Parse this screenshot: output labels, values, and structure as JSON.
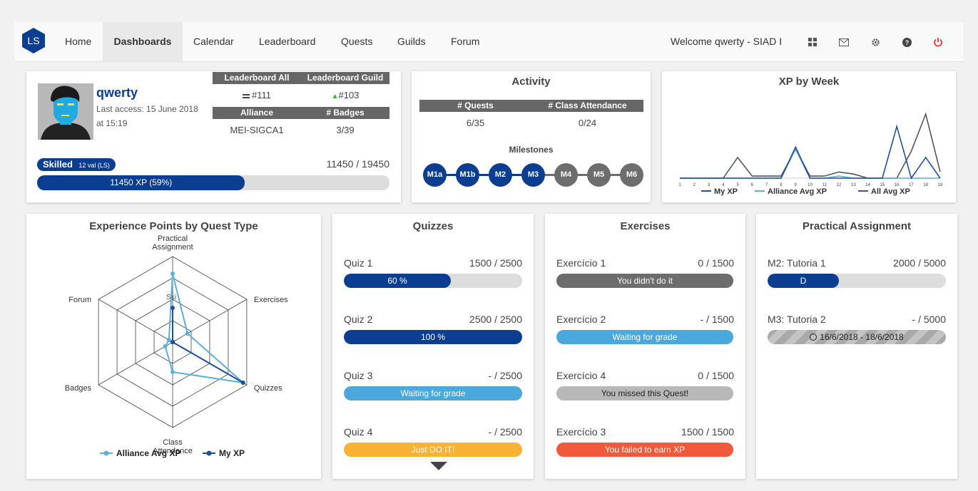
{
  "nav": {
    "logo_text": "LS",
    "items": [
      {
        "label": "Home",
        "active": false
      },
      {
        "label": "Dashboards",
        "active": true
      },
      {
        "label": "Calendar",
        "active": false
      },
      {
        "label": "Leaderboard",
        "active": false
      },
      {
        "label": "Quests",
        "active": false
      },
      {
        "label": "Guilds",
        "active": false
      },
      {
        "label": "Forum",
        "active": false
      }
    ],
    "welcome": "Welcome qwerty - SIAD I",
    "icons": [
      "grid-icon",
      "mail-icon",
      "gear-icon",
      "help-icon",
      "power-icon"
    ]
  },
  "profile": {
    "username": "qwerty",
    "last_access_line1": "Last access: 15 June 2018",
    "last_access_line2": "at 15:19",
    "lb_all_header": "Leaderboard All",
    "lb_guild_header": "Leaderboard Guild",
    "lb_all_value": "#111",
    "lb_guild_value": "#103",
    "alliance_header": "Alliance",
    "badges_header": "# Badges",
    "alliance_value": "MEI-SIGCA1",
    "badges_value": "3/39",
    "level_label": "Skilled",
    "level_sub": "12 val (LS)",
    "xp_total": "11450 / 19450",
    "xp_bar_text": "11450 XP (59%)",
    "xp_progress": 0.59,
    "accent": "#0b3d91"
  },
  "activity": {
    "title": "Activity",
    "quests_header": "# Quests",
    "attendance_header": "# Class Attendance",
    "quests_value": "6/35",
    "attendance_value": "0/24",
    "milestones_label": "Milestones",
    "milestones": [
      {
        "label": "M1a",
        "done": true
      },
      {
        "label": "M1b",
        "done": true
      },
      {
        "label": "M2",
        "done": true
      },
      {
        "label": "M3",
        "done": true
      },
      {
        "label": "M4",
        "done": false
      },
      {
        "label": "M5",
        "done": false
      },
      {
        "label": "M6",
        "done": false
      }
    ]
  },
  "xp_week": {
    "title": "XP by Week",
    "chart_data": {
      "type": "line",
      "x": [
        1,
        2,
        3,
        4,
        5,
        6,
        7,
        8,
        9,
        10,
        11,
        12,
        13,
        14,
        15,
        16,
        17,
        18,
        19
      ],
      "series": [
        {
          "name": "My XP",
          "color": "#1f4e9c",
          "values": [
            0,
            0,
            0,
            0,
            0,
            0,
            0,
            0,
            1500,
            0,
            0,
            0,
            0,
            0,
            0,
            2500,
            0,
            1000,
            0
          ]
        },
        {
          "name": "Alliance Avg XP",
          "color": "#5aaee0",
          "values": [
            0,
            0,
            0,
            0,
            0,
            0,
            0,
            0,
            1400,
            0,
            0,
            100,
            0,
            0,
            0,
            0,
            0,
            0,
            0
          ]
        },
        {
          "name": "All Avg XP",
          "color": "#555555",
          "values": [
            0,
            0,
            0,
            0,
            1000,
            100,
            100,
            100,
            1400,
            100,
            100,
            300,
            200,
            0,
            0,
            0,
            1300,
            3100,
            300
          ]
        }
      ]
    }
  },
  "radar": {
    "title": "Experience Points by Quest Type",
    "axes": [
      "Practical Assignment",
      "Exercises",
      "Quizzes",
      "Class Attendance",
      "Badges",
      "Forum"
    ],
    "axis_line1": [
      "Practical",
      "Exercises",
      "Quizzes",
      "Class",
      "Badges",
      "Forum"
    ],
    "axis_line2": [
      "Assignment",
      "",
      "",
      "Attendance",
      "",
      ""
    ],
    "center_label": "Ski",
    "chart_data": {
      "type": "radar",
      "series": [
        {
          "name": "Alliance Avg XP",
          "color": "#5aaee0",
          "values": [
            0.8,
            0.2,
            0.95,
            0.35,
            0.1,
            0.05
          ]
        },
        {
          "name": "My XP",
          "color": "#1f4e9c",
          "values": [
            0.4,
            0.0,
            0.95,
            0.0,
            0.0,
            0.0
          ]
        }
      ]
    },
    "legend": [
      "Alliance Avg XP",
      "My XP"
    ]
  },
  "quizzes": {
    "title": "Quizzes",
    "rows": [
      {
        "label": "Quiz 1",
        "score": "1500 / 2500",
        "bar_text": "60 %",
        "progress": 0.6,
        "color": "#0b3d91"
      },
      {
        "label": "Quiz 2",
        "score": "2500 / 2500",
        "bar_text": "100 %",
        "progress": 1.0,
        "color": "#0b3d91"
      },
      {
        "label": "Quiz 3",
        "score": "- / 2500",
        "bar_text": "Waiting for grade",
        "progress": 1.0,
        "color": "#4aa8dc"
      },
      {
        "label": "Quiz 4",
        "score": "- / 2500",
        "bar_text": "Just DO IT!",
        "progress": 1.0,
        "color": "#f9b233"
      }
    ]
  },
  "exercises": {
    "title": "Exercises",
    "rows": [
      {
        "label": "Exercício 1",
        "score": "0 / 1500",
        "bar_text": "You didn't do it",
        "color": "#6d6d6d",
        "text_color": "#ffffff"
      },
      {
        "label": "Exercício 2",
        "score": "- / 1500",
        "bar_text": "Waiting for grade",
        "color": "#4aa8dc",
        "text_color": "#ffffff"
      },
      {
        "label": "Exercício 4",
        "score": "0 / 1500",
        "bar_text": "You missed this Quest!",
        "color": "#b8b8b8",
        "text_color": "#222222"
      },
      {
        "label": "Exercício 3",
        "score": "1500 / 1500",
        "bar_text": "You failed to earn XP",
        "color": "#f05a3a",
        "text_color": "#ffffff"
      }
    ]
  },
  "practical": {
    "title": "Practical Assignment",
    "rows": [
      {
        "label": "M2: Tutoria 1",
        "score": "2000 / 5000",
        "bar_text": "D",
        "progress": 0.4,
        "color": "#0b3d91"
      },
      {
        "label": "M3: Tutoria 2",
        "score": "- / 5000",
        "bar_text": "16/6/2018 - 18/6/2018",
        "progress": 1.0,
        "color": "#b0b0b0"
      }
    ]
  }
}
